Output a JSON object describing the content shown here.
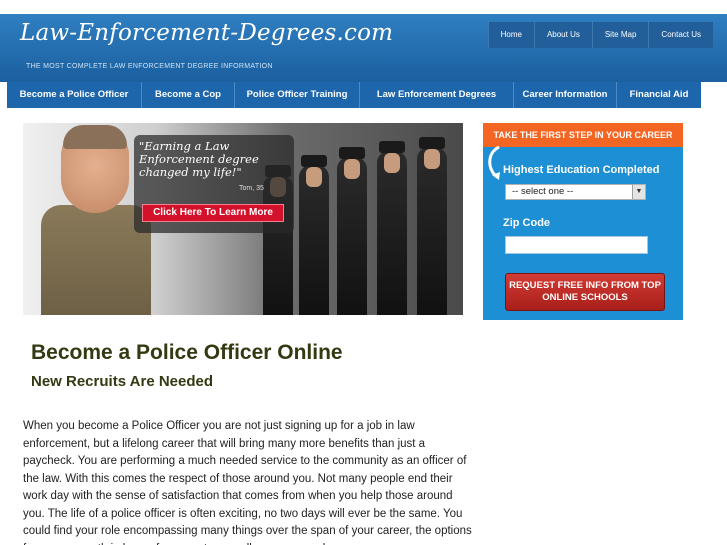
{
  "header": {
    "site_title": "Law-Enforcement-Degrees.com",
    "tagline": "THE MOST COMPLETE LAW ENFORCEMENT DEGREE INFORMATION",
    "top_nav": [
      "Home",
      "About Us",
      "Site Map",
      "Contact Us"
    ]
  },
  "main_nav": [
    "Become a Police Officer",
    "Become a Cop",
    "Police Officer Training",
    "Law Enforcement Degrees",
    "Career Information",
    "Financial Aid"
  ],
  "hero": {
    "quote": "\"Earning a Law Enforcement degree changed my life!\"",
    "attribution": "Tom, 35",
    "cta_label": "Click Here To Learn More"
  },
  "form": {
    "header": "TAKE THE FIRST STEP IN YOUR CAREER",
    "education_label": "Highest Education Completed",
    "education_selected": "-- select one --",
    "zip_label": "Zip Code",
    "zip_value": "",
    "submit_label": "REQUEST FREE INFO FROM TOP ONLINE SCHOOLS"
  },
  "content": {
    "title": "Become a Police Officer Online",
    "subtitle": "New Recruits Are Needed",
    "paragraph": "When you become a Police Officer you are not just signing up for a job in law enforcement, but a lifelong career that will bring many more benefits than just a paycheck. You are performing a much needed service to the community as an officer of the law. With this comes the respect of those around you. Not many people end their work day with the sense of satisfaction that comes from when you help those around you. The life of a police officer is often exciting, no two days will ever be the same. You could find your role encompassing many things over the span of your career, the options for a career path in law enforcement are endless once you have"
  },
  "colors": {
    "header_blue": "#1b5f9f",
    "nav_blue": "#1d66ac",
    "form_blue": "#1d8fd4",
    "form_header_orange": "#f26522",
    "cta_red": "#d3112a",
    "title_olive": "#333a12"
  }
}
